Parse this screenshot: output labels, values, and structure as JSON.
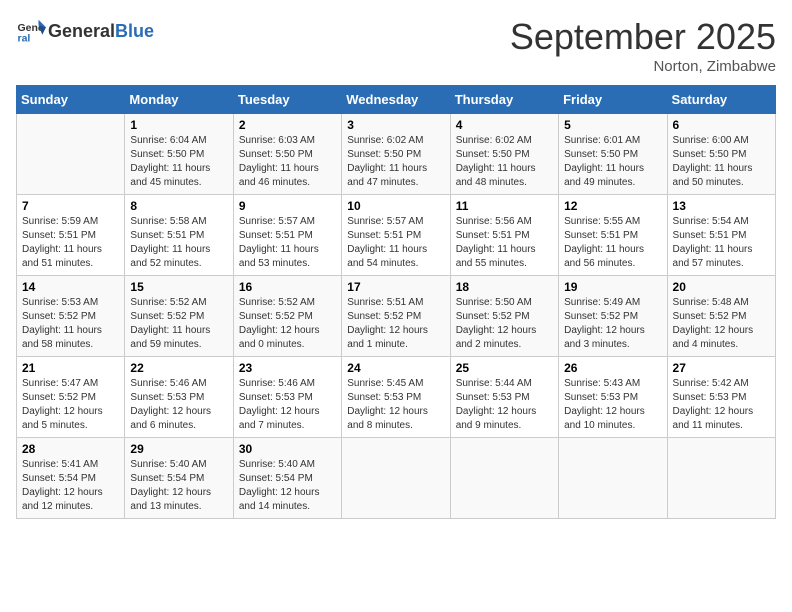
{
  "header": {
    "logo_general": "General",
    "logo_blue": "Blue",
    "month_title": "September 2025",
    "subtitle": "Norton, Zimbabwe"
  },
  "days_of_week": [
    "Sunday",
    "Monday",
    "Tuesday",
    "Wednesday",
    "Thursday",
    "Friday",
    "Saturday"
  ],
  "weeks": [
    [
      {
        "day": "",
        "info": ""
      },
      {
        "day": "1",
        "info": "Sunrise: 6:04 AM\nSunset: 5:50 PM\nDaylight: 11 hours\nand 45 minutes."
      },
      {
        "day": "2",
        "info": "Sunrise: 6:03 AM\nSunset: 5:50 PM\nDaylight: 11 hours\nand 46 minutes."
      },
      {
        "day": "3",
        "info": "Sunrise: 6:02 AM\nSunset: 5:50 PM\nDaylight: 11 hours\nand 47 minutes."
      },
      {
        "day": "4",
        "info": "Sunrise: 6:02 AM\nSunset: 5:50 PM\nDaylight: 11 hours\nand 48 minutes."
      },
      {
        "day": "5",
        "info": "Sunrise: 6:01 AM\nSunset: 5:50 PM\nDaylight: 11 hours\nand 49 minutes."
      },
      {
        "day": "6",
        "info": "Sunrise: 6:00 AM\nSunset: 5:50 PM\nDaylight: 11 hours\nand 50 minutes."
      }
    ],
    [
      {
        "day": "7",
        "info": "Sunrise: 5:59 AM\nSunset: 5:51 PM\nDaylight: 11 hours\nand 51 minutes."
      },
      {
        "day": "8",
        "info": "Sunrise: 5:58 AM\nSunset: 5:51 PM\nDaylight: 11 hours\nand 52 minutes."
      },
      {
        "day": "9",
        "info": "Sunrise: 5:57 AM\nSunset: 5:51 PM\nDaylight: 11 hours\nand 53 minutes."
      },
      {
        "day": "10",
        "info": "Sunrise: 5:57 AM\nSunset: 5:51 PM\nDaylight: 11 hours\nand 54 minutes."
      },
      {
        "day": "11",
        "info": "Sunrise: 5:56 AM\nSunset: 5:51 PM\nDaylight: 11 hours\nand 55 minutes."
      },
      {
        "day": "12",
        "info": "Sunrise: 5:55 AM\nSunset: 5:51 PM\nDaylight: 11 hours\nand 56 minutes."
      },
      {
        "day": "13",
        "info": "Sunrise: 5:54 AM\nSunset: 5:51 PM\nDaylight: 11 hours\nand 57 minutes."
      }
    ],
    [
      {
        "day": "14",
        "info": "Sunrise: 5:53 AM\nSunset: 5:52 PM\nDaylight: 11 hours\nand 58 minutes."
      },
      {
        "day": "15",
        "info": "Sunrise: 5:52 AM\nSunset: 5:52 PM\nDaylight: 11 hours\nand 59 minutes."
      },
      {
        "day": "16",
        "info": "Sunrise: 5:52 AM\nSunset: 5:52 PM\nDaylight: 12 hours\nand 0 minutes."
      },
      {
        "day": "17",
        "info": "Sunrise: 5:51 AM\nSunset: 5:52 PM\nDaylight: 12 hours\nand 1 minute."
      },
      {
        "day": "18",
        "info": "Sunrise: 5:50 AM\nSunset: 5:52 PM\nDaylight: 12 hours\nand 2 minutes."
      },
      {
        "day": "19",
        "info": "Sunrise: 5:49 AM\nSunset: 5:52 PM\nDaylight: 12 hours\nand 3 minutes."
      },
      {
        "day": "20",
        "info": "Sunrise: 5:48 AM\nSunset: 5:52 PM\nDaylight: 12 hours\nand 4 minutes."
      }
    ],
    [
      {
        "day": "21",
        "info": "Sunrise: 5:47 AM\nSunset: 5:52 PM\nDaylight: 12 hours\nand 5 minutes."
      },
      {
        "day": "22",
        "info": "Sunrise: 5:46 AM\nSunset: 5:53 PM\nDaylight: 12 hours\nand 6 minutes."
      },
      {
        "day": "23",
        "info": "Sunrise: 5:46 AM\nSunset: 5:53 PM\nDaylight: 12 hours\nand 7 minutes."
      },
      {
        "day": "24",
        "info": "Sunrise: 5:45 AM\nSunset: 5:53 PM\nDaylight: 12 hours\nand 8 minutes."
      },
      {
        "day": "25",
        "info": "Sunrise: 5:44 AM\nSunset: 5:53 PM\nDaylight: 12 hours\nand 9 minutes."
      },
      {
        "day": "26",
        "info": "Sunrise: 5:43 AM\nSunset: 5:53 PM\nDaylight: 12 hours\nand 10 minutes."
      },
      {
        "day": "27",
        "info": "Sunrise: 5:42 AM\nSunset: 5:53 PM\nDaylight: 12 hours\nand 11 minutes."
      }
    ],
    [
      {
        "day": "28",
        "info": "Sunrise: 5:41 AM\nSunset: 5:54 PM\nDaylight: 12 hours\nand 12 minutes."
      },
      {
        "day": "29",
        "info": "Sunrise: 5:40 AM\nSunset: 5:54 PM\nDaylight: 12 hours\nand 13 minutes."
      },
      {
        "day": "30",
        "info": "Sunrise: 5:40 AM\nSunset: 5:54 PM\nDaylight: 12 hours\nand 14 minutes."
      },
      {
        "day": "",
        "info": ""
      },
      {
        "day": "",
        "info": ""
      },
      {
        "day": "",
        "info": ""
      },
      {
        "day": "",
        "info": ""
      }
    ]
  ]
}
